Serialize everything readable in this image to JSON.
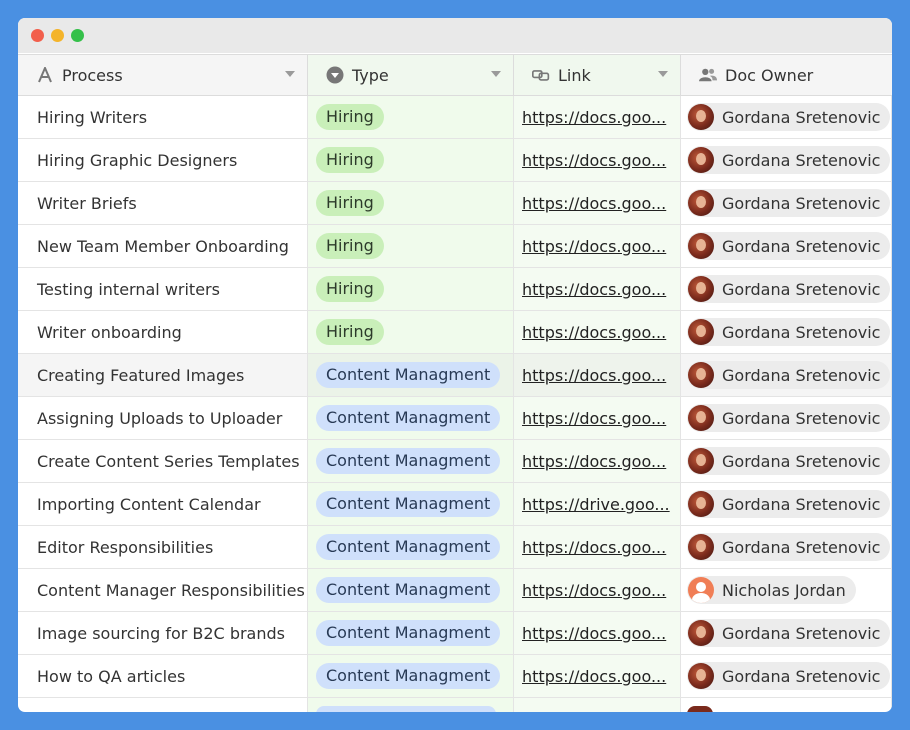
{
  "window": {
    "controls": [
      "close",
      "minimize",
      "maximize"
    ]
  },
  "columns": [
    {
      "label": "Process",
      "icon": "text-field-icon"
    },
    {
      "label": "Type",
      "icon": "single-select-icon"
    },
    {
      "label": "Link",
      "icon": "link-icon"
    },
    {
      "label": "Doc Owner",
      "icon": "people-icon"
    }
  ],
  "rows": [
    {
      "process": "Hiring Writers",
      "type": "Hiring",
      "link": "https://docs.goo...",
      "owner": "Gordana Sretenovic"
    },
    {
      "process": "Hiring Graphic Designers",
      "type": "Hiring",
      "link": "https://docs.goo...",
      "owner": "Gordana Sretenovic"
    },
    {
      "process": "Writer Briefs",
      "type": "Hiring",
      "link": "https://docs.goo...",
      "owner": "Gordana Sretenovic"
    },
    {
      "process": "New Team Member Onboarding",
      "type": "Hiring",
      "link": "https://docs.goo...",
      "owner": "Gordana Sretenovic"
    },
    {
      "process": "Testing internal writers",
      "type": "Hiring",
      "link": "https://docs.goo...",
      "owner": "Gordana Sretenovic"
    },
    {
      "process": "Writer onboarding",
      "type": "Hiring",
      "link": "https://docs.goo...",
      "owner": "Gordana Sretenovic"
    },
    {
      "process": "Creating Featured Images",
      "type": "Content Managment",
      "link": "https://docs.goo...",
      "owner": "Gordana Sretenovic"
    },
    {
      "process": "Assigning Uploads to Uploader",
      "type": "Content Managment",
      "link": "https://docs.goo...",
      "owner": "Gordana Sretenovic"
    },
    {
      "process": "Create Content Series Templates",
      "type": "Content Managment",
      "link": "https://docs.goo...",
      "owner": "Gordana Sretenovic"
    },
    {
      "process": "Importing Content Calendar",
      "type": "Content Managment",
      "link": "https://drive.goo...",
      "owner": "Gordana Sretenovic"
    },
    {
      "process": "Editor Responsibilities",
      "type": "Content Managment",
      "link": "https://docs.goo...",
      "owner": "Gordana Sretenovic"
    },
    {
      "process": "Content Manager Responsibilities",
      "type": "Content Managment",
      "link": "https://docs.goo...",
      "owner": "Nicholas Jordan"
    },
    {
      "process": "Image sourcing for B2C brands",
      "type": "Content Managment",
      "link": "https://docs.goo...",
      "owner": "Gordana Sretenovic"
    },
    {
      "process": "How to QA articles",
      "type": "Content Managment",
      "link": "https://docs.goo...",
      "owner": "Gordana Sretenovic"
    }
  ],
  "colors": {
    "background": "#4a90e2",
    "hiring_pill": "#c9efb9",
    "content_pill": "#cfe0fb"
  }
}
